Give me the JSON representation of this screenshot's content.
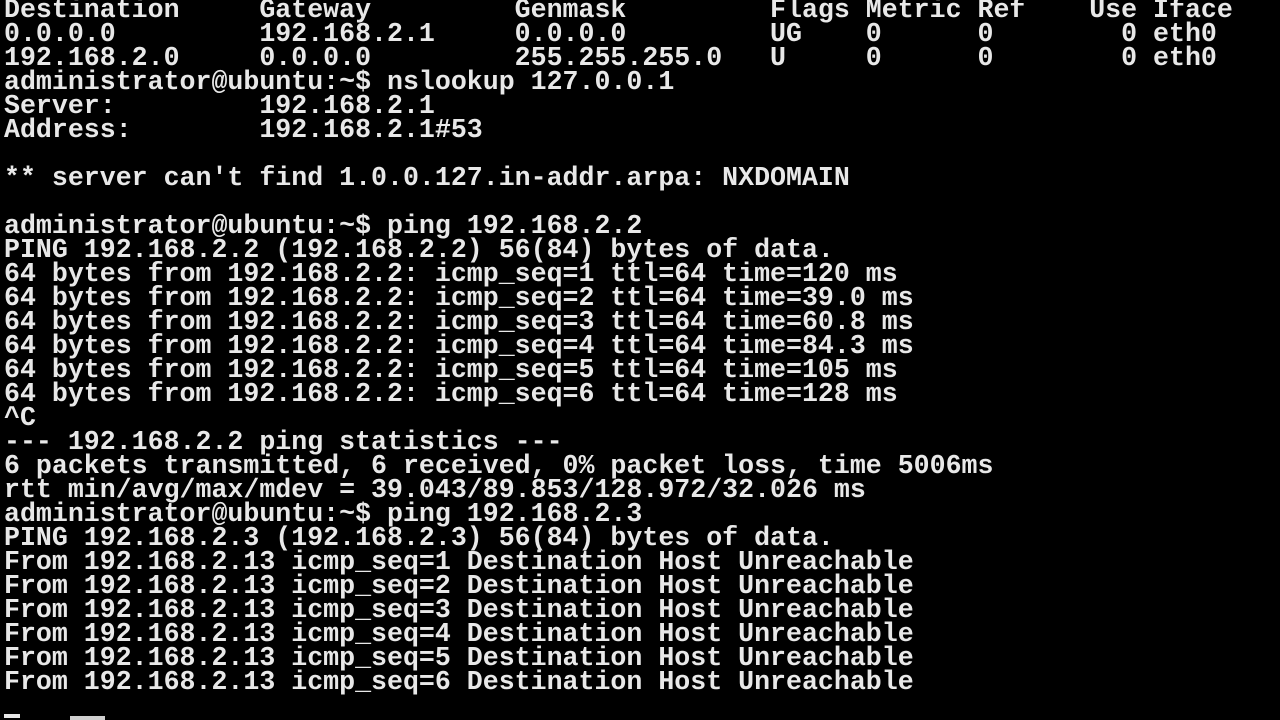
{
  "terminal": {
    "lines": [
      "Destination     Gateway         Genmask         Flags Metric Ref    Use Iface",
      "0.0.0.0         192.168.2.1     0.0.0.0         UG    0      0        0 eth0",
      "192.168.2.0     0.0.0.0         255.255.255.0   U     0      0        0 eth0",
      "administrator@ubuntu:~$ nslookup 127.0.0.1",
      "Server:         192.168.2.1",
      "Address:        192.168.2.1#53",
      "",
      "** server can't find 1.0.0.127.in-addr.arpa: NXDOMAIN",
      "",
      "administrator@ubuntu:~$ ping 192.168.2.2",
      "PING 192.168.2.2 (192.168.2.2) 56(84) bytes of data.",
      "64 bytes from 192.168.2.2: icmp_seq=1 ttl=64 time=120 ms",
      "64 bytes from 192.168.2.2: icmp_seq=2 ttl=64 time=39.0 ms",
      "64 bytes from 192.168.2.2: icmp_seq=3 ttl=64 time=60.8 ms",
      "64 bytes from 192.168.2.2: icmp_seq=4 ttl=64 time=84.3 ms",
      "64 bytes from 192.168.2.2: icmp_seq=5 ttl=64 time=105 ms",
      "64 bytes from 192.168.2.2: icmp_seq=6 ttl=64 time=128 ms",
      "^C",
      "--- 192.168.2.2 ping statistics ---",
      "6 packets transmitted, 6 received, 0% packet loss, time 5006ms",
      "rtt min/avg/max/mdev = 39.043/89.853/128.972/32.026 ms",
      "administrator@ubuntu:~$ ping 192.168.2.3",
      "PING 192.168.2.3 (192.168.2.3) 56(84) bytes of data.",
      "From 192.168.2.13 icmp_seq=1 Destination Host Unreachable",
      "From 192.168.2.13 icmp_seq=2 Destination Host Unreachable",
      "From 192.168.2.13 icmp_seq=3 Destination Host Unreachable",
      "From 192.168.2.13 icmp_seq=4 Destination Host Unreachable",
      "From 192.168.2.13 icmp_seq=5 Destination Host Unreachable",
      "From 192.168.2.13 icmp_seq=6 Destination Host Unreachable"
    ],
    "colors": {
      "background": "#000000",
      "foreground": "#e8e8e8"
    }
  }
}
